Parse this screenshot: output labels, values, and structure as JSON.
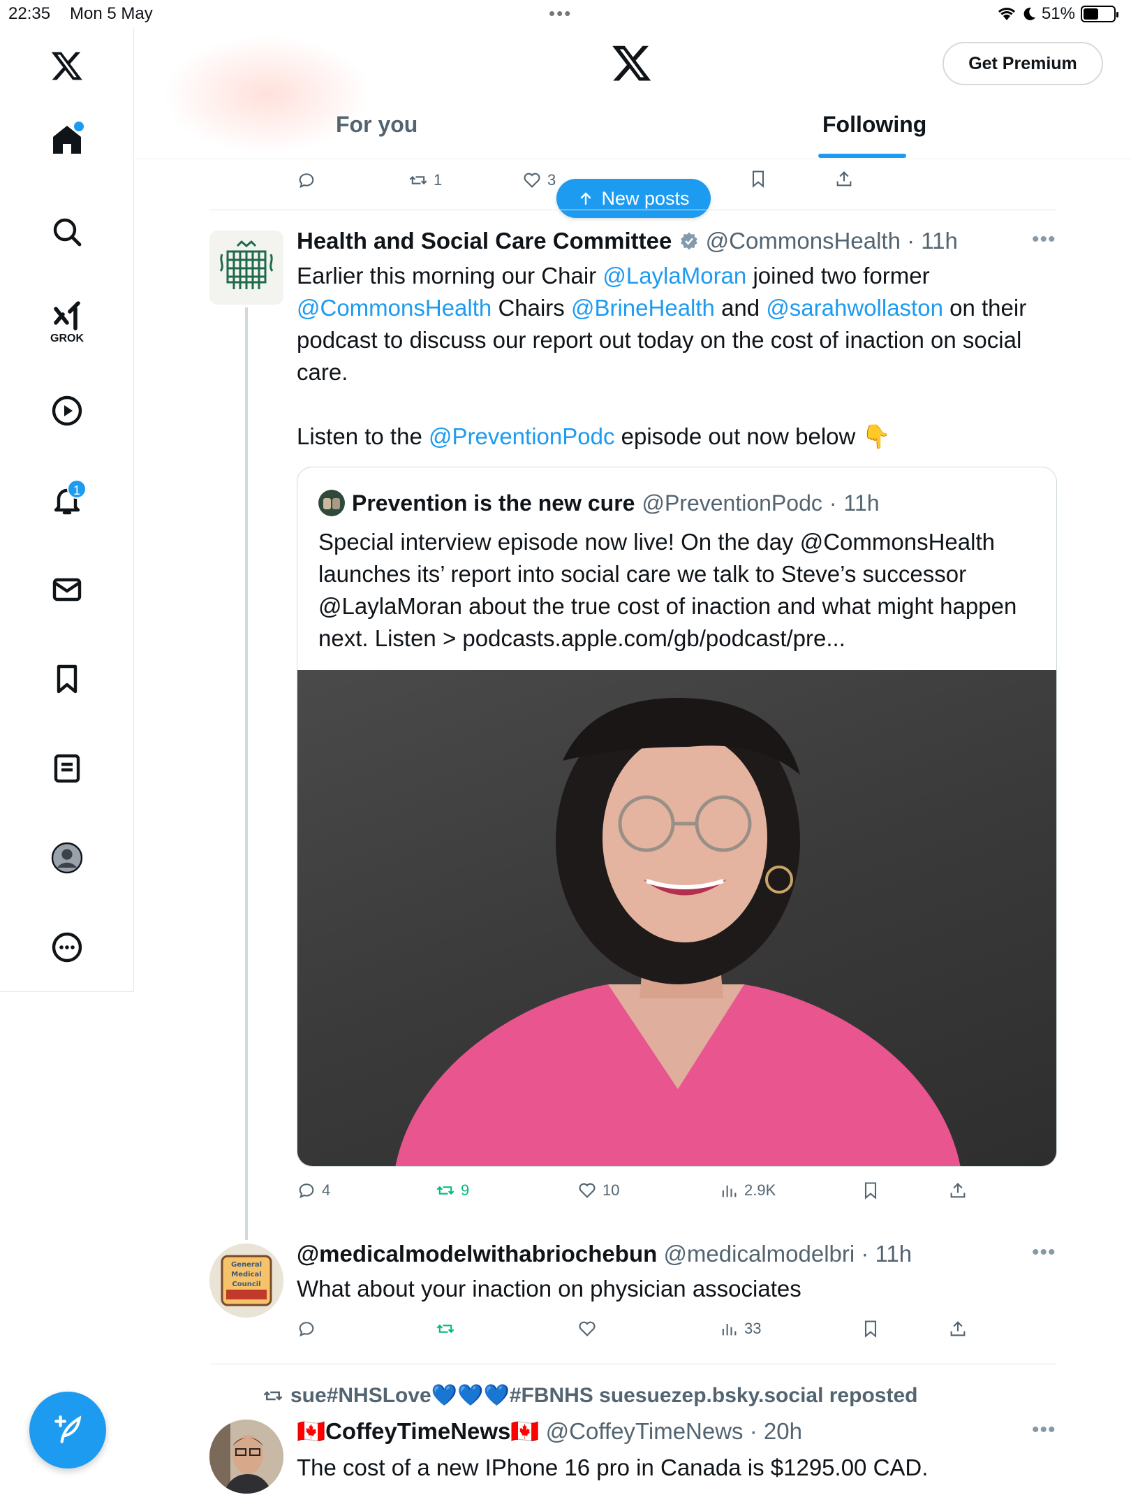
{
  "status_bar": {
    "time": "22:35",
    "date": "Mon 5 May",
    "battery": "51%",
    "battery_level": 0.51
  },
  "sidebar": {
    "items": [
      {
        "name": "x-logo-icon"
      },
      {
        "name": "home-icon"
      },
      {
        "name": "search-icon"
      },
      {
        "name": "grok-icon",
        "label": "GROK"
      },
      {
        "name": "play-icon"
      },
      {
        "name": "bell-icon",
        "badge": "1"
      },
      {
        "name": "mail-icon"
      },
      {
        "name": "bookmark-icon"
      },
      {
        "name": "list-icon"
      },
      {
        "name": "profile-icon"
      },
      {
        "name": "more-circle-icon"
      }
    ]
  },
  "header": {
    "premium_label": "Get Premium",
    "tabs": [
      {
        "label": "For you"
      },
      {
        "label": "Following"
      }
    ],
    "active_tab": "Following"
  },
  "new_posts_label": "New posts",
  "prev_tweet_actions": {
    "retweets": "1",
    "likes": "3"
  },
  "tweet1": {
    "name": "Health and Social Care Committee",
    "handle": "@CommonsHealth",
    "time": "11h",
    "body": {
      "p1": "Earlier this morning our Chair",
      "m1": "@LaylaMoran",
      "p2": "joined two former",
      "m2": "@CommonsHealth",
      "p3": "Chairs",
      "m3": "@BrineHealth",
      "p4": "and",
      "m4": "@sarahwollaston",
      "p5": "on their podcast to discuss our report out today on the cost of inaction on social care.",
      "p6": "Listen to the",
      "m5": "@PreventionPodc",
      "p7": "episode out now below 👇"
    },
    "quote": {
      "name": "Prevention is the new cure",
      "handle": "@PreventionPodc",
      "time": "11h",
      "text": "Special interview episode now live! On the day @CommonsHealth launches its’ report into social care we talk to Steve’s successor @LaylaMoran about the true cost of inaction and what might happen next. Listen > podcasts.apple.com/gb/podcast/pre..."
    },
    "actions": {
      "replies": "4",
      "retweets": "9",
      "likes": "10",
      "views": "2.9K"
    }
  },
  "tweet2": {
    "name": "@medicalmodelwithabriochebun",
    "handle": "@medicalmodelbri",
    "time": "11h",
    "text": "What about your inaction on physician associates",
    "avatar_text": "General Medical Council",
    "actions": {
      "views": "33"
    }
  },
  "tweet3": {
    "reposted_by": "sue#NHSLove💙💙💙#FBNHS suesuezep.bsky.social reposted",
    "name": "🇨🇦CoffeyTimeNews🇨🇦",
    "handle": "@CoffeyTimeNews",
    "time": "20h",
    "text": "The cost of a new IPhone 16 pro in Canada is $1295.00 CAD."
  },
  "colors": {
    "accent": "#1d9bf0",
    "muted": "#536471",
    "retweet_green": "#00ba7c"
  }
}
